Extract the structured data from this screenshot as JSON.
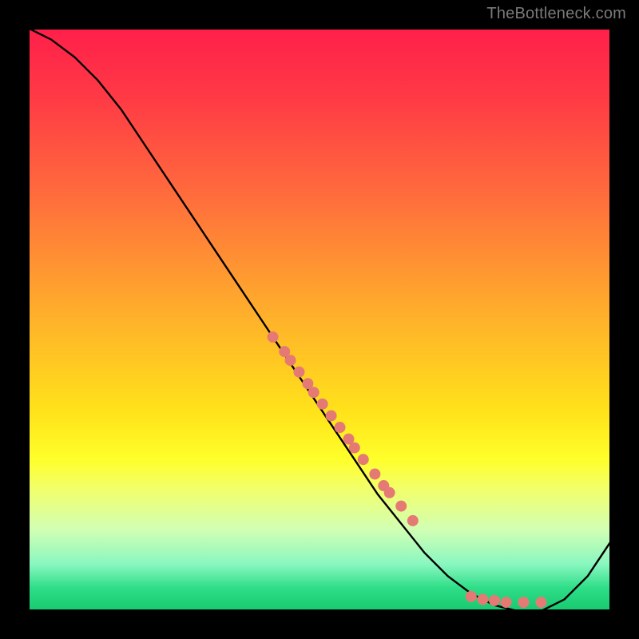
{
  "watermark": "TheBottleneck.com",
  "colors": {
    "curve_stroke": "#000000",
    "dot_fill": "#e57a74",
    "frame_border": "#000000"
  },
  "chart_data": {
    "type": "line",
    "title": "",
    "xlabel": "",
    "ylabel": "",
    "xlim": [
      0,
      100
    ],
    "ylim": [
      0,
      100
    ],
    "grid": false,
    "legend": false,
    "series": [
      {
        "name": "bottleneck-curve",
        "x": [
          0,
          4,
          8,
          12,
          16,
          20,
          24,
          28,
          32,
          36,
          40,
          44,
          48,
          52,
          56,
          60,
          64,
          68,
          72,
          76,
          80,
          84,
          88,
          92,
          96,
          100
        ],
        "y": [
          100,
          98,
          95,
          91,
          86,
          80,
          74,
          68,
          62,
          56,
          50,
          44,
          38,
          32,
          26,
          20,
          15,
          10,
          6,
          3,
          1,
          0,
          0,
          2,
          6,
          12
        ]
      }
    ],
    "overlay_points": {
      "name": "highlighted-dots",
      "x": [
        42.0,
        44.0,
        45.0,
        46.5,
        48.0,
        49.0,
        50.5,
        52.0,
        53.5,
        55.0,
        56.0,
        57.5,
        59.5,
        61.0,
        62.0,
        64.0,
        66.0,
        76.0,
        78.0,
        80.0,
        82.0,
        85.0,
        88.0
      ],
      "y": [
        47.0,
        44.5,
        43.0,
        41.0,
        39.0,
        37.5,
        35.5,
        33.5,
        31.5,
        29.5,
        28.0,
        26.0,
        23.5,
        21.5,
        20.3,
        18.0,
        15.5,
        2.5,
        2.0,
        1.8,
        1.5,
        1.5,
        1.5
      ]
    }
  }
}
